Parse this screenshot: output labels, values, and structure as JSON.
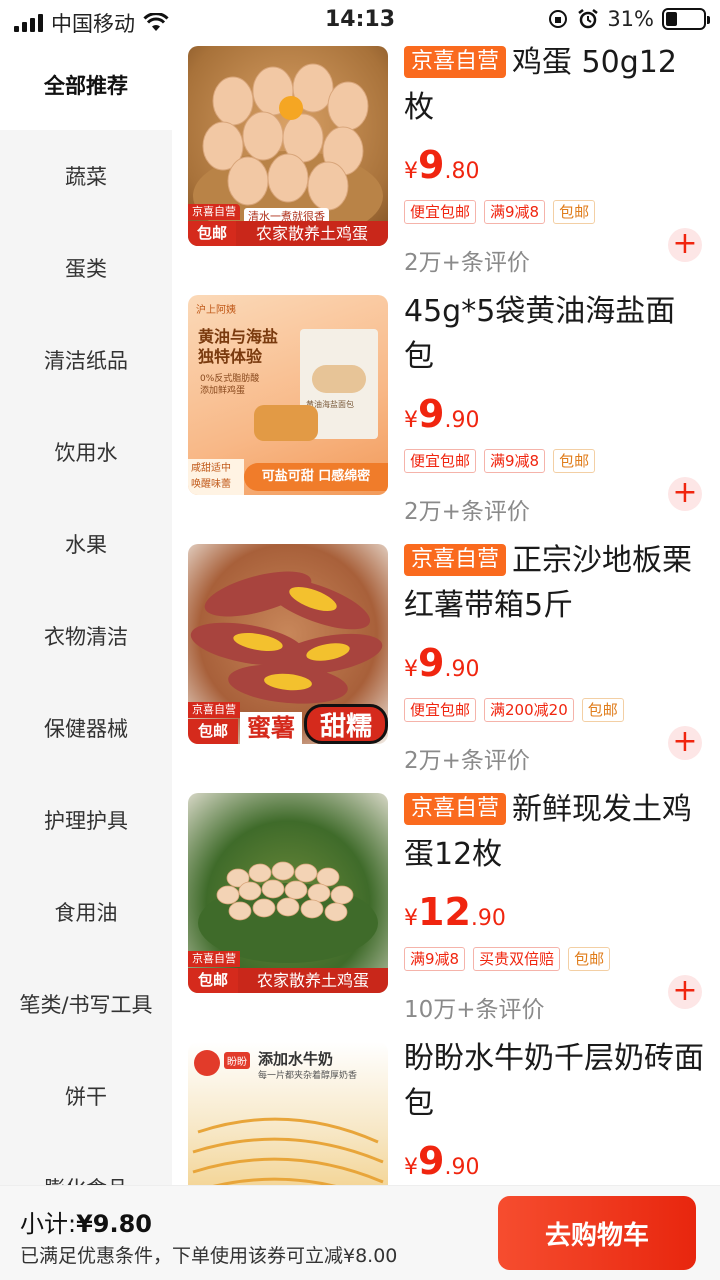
{
  "status_bar": {
    "carrier": "中国移动",
    "time": "14:13",
    "battery": "31%",
    "battery_level": 0.31
  },
  "sidebar": {
    "items": [
      {
        "label": "全部推荐",
        "active": true
      },
      {
        "label": "蔬菜"
      },
      {
        "label": "蛋类"
      },
      {
        "label": "清洁纸品"
      },
      {
        "label": "饮用水"
      },
      {
        "label": "水果"
      },
      {
        "label": "衣物清洁"
      },
      {
        "label": "保健器械"
      },
      {
        "label": "护理护具"
      },
      {
        "label": "食用油"
      },
      {
        "label": "笔类/书写工具"
      },
      {
        "label": "饼干"
      },
      {
        "label": "膨化食品"
      }
    ]
  },
  "products": [
    {
      "badge": "京喜自营",
      "title": "鸡蛋 50g12枚",
      "price_yen": "¥",
      "price_int": "9",
      "price_dec": ".80",
      "tags": [
        "便宜包邮",
        "满9减8",
        "包邮"
      ],
      "reviews": "2万+条评价",
      "image_caption": "农家散养土鸡蛋",
      "image_badge": "京喜自营",
      "image_badge2": "包邮",
      "image_sub": "清水一煮就很香"
    },
    {
      "badge": "",
      "title": "45g*5袋黄油海盐面包",
      "price_yen": "¥",
      "price_int": "9",
      "price_dec": ".90",
      "tags": [
        "便宜包邮",
        "满9减8",
        "包邮"
      ],
      "reviews": "2万+条评价",
      "image_brand": "沪上阿姨",
      "image_headline": "黄油与海盐 独特体验",
      "image_bullets": [
        "0%反式脂肪酸",
        "添加鲜鸡蛋"
      ],
      "image_pack": "黄油海盐面包",
      "image_caption_left": "咸甜适中 唤醒味蕾",
      "image_caption_right": "可盐可甜 口感绵密"
    },
    {
      "badge": "京喜自营",
      "title": "正宗沙地板栗红薯带箱5斤",
      "price_yen": "¥",
      "price_int": "9",
      "price_dec": ".90",
      "tags": [
        "便宜包邮",
        "满200减20",
        "包邮"
      ],
      "reviews": "2万+条评价",
      "image_badge": "京喜自营",
      "image_badge2": "包邮",
      "image_caption": "蜜薯",
      "image_caption2": "甜糯"
    },
    {
      "badge": "京喜自营",
      "title": "新鲜现发土鸡蛋12枚",
      "price_yen": "¥",
      "price_int": "12",
      "price_dec": ".90",
      "tags": [
        "满9减8",
        "买贵双倍赔",
        "包邮"
      ],
      "reviews": "10万+条评价",
      "image_badge": "京喜自营",
      "image_badge2": "包邮",
      "image_caption": "农家散养土鸡蛋"
    },
    {
      "badge": "",
      "title": "盼盼水牛奶千层奶砖面包",
      "price_yen": "¥",
      "price_int": "9",
      "price_dec": ".90",
      "tags": [],
      "reviews": "",
      "image_headline": "添加水牛奶",
      "image_sub": "每一片都夹杂着醇厚奶香",
      "image_brand": "盼盼"
    }
  ],
  "bottom_bar": {
    "subtotal_label": "小计:",
    "subtotal_value": "¥9.80",
    "hint": "已满足优惠条件，下单使用该券可立减¥8.00",
    "cart_button": "去购物车"
  },
  "colors": {
    "accent": "#f0250f",
    "ziying": "#fa6a1e"
  }
}
